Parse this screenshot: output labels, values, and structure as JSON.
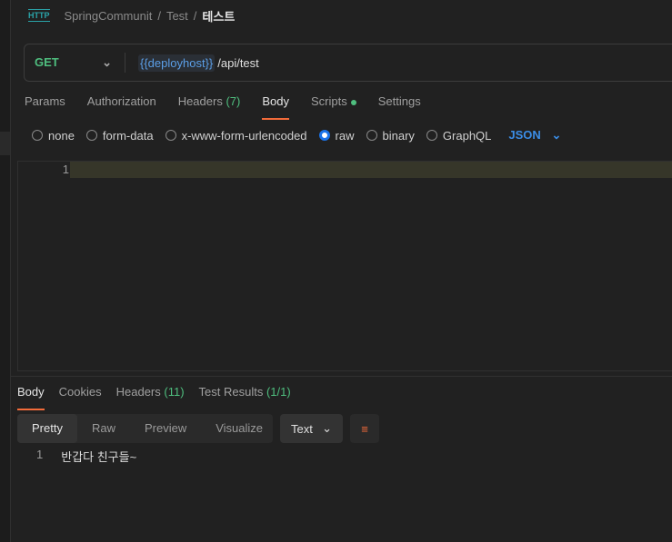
{
  "breadcrumb": {
    "icon": "HTTP",
    "items": [
      "SpringCommunit",
      "Test"
    ],
    "current": "테스트"
  },
  "request": {
    "method": "GET",
    "url_var": "{{deployhost}}",
    "url_path": "/api/test"
  },
  "tabs": [
    {
      "label": "Params"
    },
    {
      "label": "Authorization"
    },
    {
      "label": "Headers",
      "count": "(7)"
    },
    {
      "label": "Body"
    },
    {
      "label": "Scripts"
    },
    {
      "label": "Settings"
    }
  ],
  "body_types": [
    "none",
    "form-data",
    "x-www-form-urlencoded",
    "raw",
    "binary",
    "GraphQL"
  ],
  "body_selected": "raw",
  "format": "JSON",
  "editor": {
    "line": "1"
  },
  "response": {
    "tabs": [
      {
        "label": "Body"
      },
      {
        "label": "Cookies"
      },
      {
        "label": "Headers",
        "count": "(11)"
      },
      {
        "label": "Test Results",
        "count": "(1/1)"
      }
    ],
    "views": [
      "Pretty",
      "Raw",
      "Preview",
      "Visualize"
    ],
    "type": "Text",
    "line": "1",
    "content": "반갑다 친구들~"
  },
  "colors": {
    "accent": "#f26b3a",
    "green": "#4fbf7f",
    "blue": "#3b8de6"
  }
}
